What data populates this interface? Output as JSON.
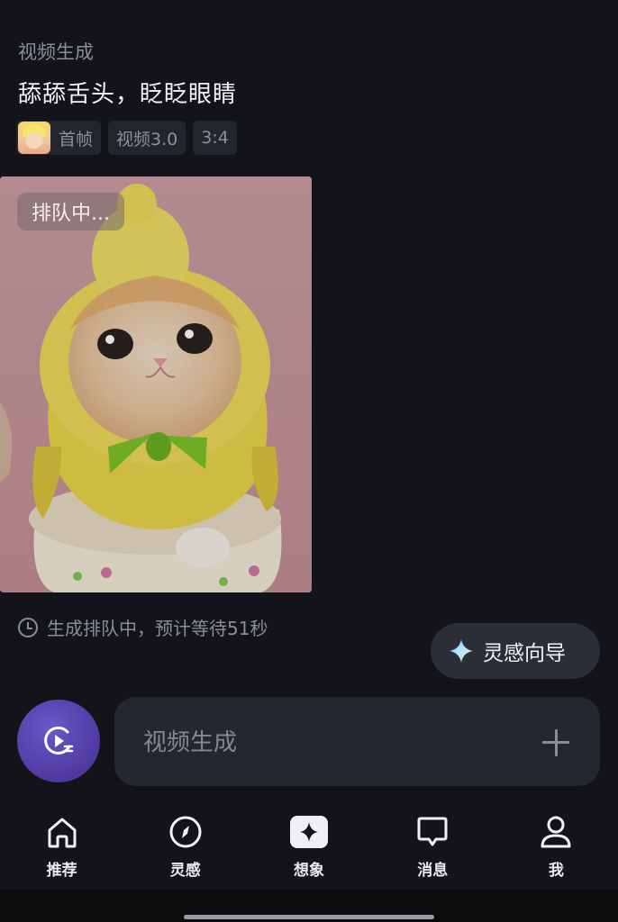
{
  "section_label": "视频生成",
  "prompt": "舔舔舌头，眨眨眼睛",
  "tags": {
    "first_frame": "首帧",
    "model": "视频3.0",
    "ratio": "3:4"
  },
  "media": {
    "badge": "排队中..."
  },
  "status_text": "生成排队中，预计等待51秒",
  "guide_button": "灵感向导",
  "input": {
    "placeholder": "视频生成"
  },
  "nav": {
    "items": [
      {
        "label": "推荐",
        "icon": "home-icon"
      },
      {
        "label": "灵感",
        "icon": "compass-icon"
      },
      {
        "label": "想象",
        "icon": "sparkle-icon",
        "active": true
      },
      {
        "label": "消息",
        "icon": "chat-bubble-icon"
      },
      {
        "label": "我",
        "icon": "person-icon"
      }
    ]
  },
  "colors": {
    "background": "#131419",
    "accent_purple": "#4e3aa0",
    "muted_text": "#8b8e97"
  }
}
